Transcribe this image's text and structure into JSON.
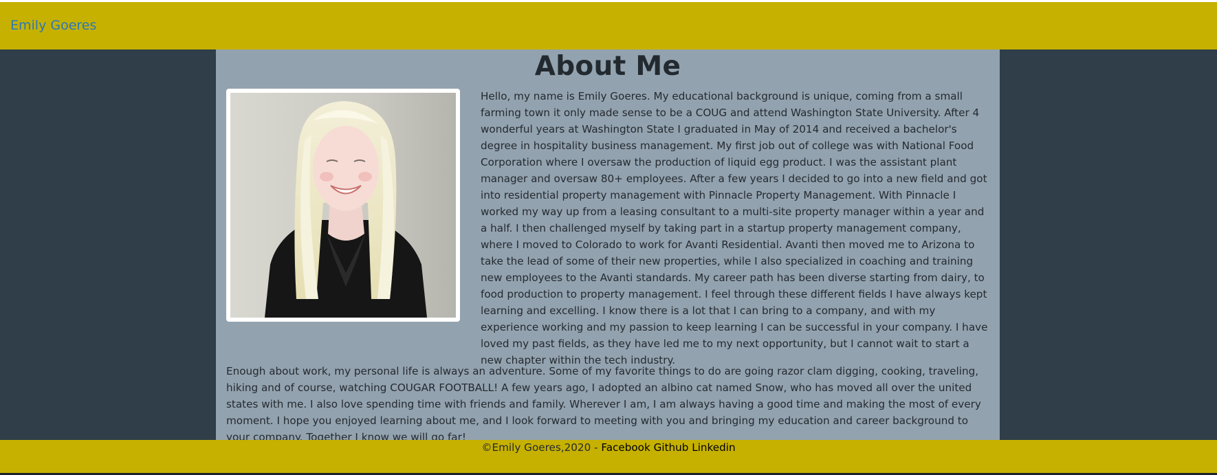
{
  "navbar": {
    "brand": "Emily Goeres",
    "background_color": "#c6b100",
    "brand_color": "#2a78b8"
  },
  "main": {
    "title": "About Me",
    "photo": {
      "description_icon": "portrait-photo"
    },
    "paragraphs": [
      "Hello, my name is Emily Goeres. My educational background is unique, coming from a small farming town it only made sense to be a COUG and attend Washington State University. After 4 wonderful years at Washington State I graduated in May of 2014 and received a bachelor's degree in hospitality business management. My first job out of college was with National Food Corporation where I oversaw the production of liquid egg product. I was the assistant plant manager and oversaw 80+ employees. After a few years I decided to go into a new field and got into residential property management with Pinnacle Property Management. With Pinnacle I worked my way up from a leasing consultant to a multi-site property manager within a year and a half. I then challenged myself by taking part in a startup property management company, where I moved to Colorado to work for Avanti Residential. Avanti then moved me to Arizona to take the lead of some of their new properties, while I also specialized in coaching and training new employees to the Avanti standards. My career path has been diverse starting from dairy, to food production to property management. I feel through these different fields I have always kept learning and excelling. I know there is a lot that I can bring to a company, and with my experience working and my passion to keep learning I can be successful in your company. I have loved my past fields, as they have led me to my next opportunity, but I cannot wait to start a new chapter within the tech industry.",
      "Enough about work, my personal life is always an adventure. Some of my favorite things to do are going razor clam digging, cooking, traveling, hiking and of course, watching COUGAR FOOTBALL! A few years ago, I adopted an albino cat named Snow, who has moved all over the united states with me. I also love spending time with friends and family. Wherever I am, I am always having a good time and making the most of every moment. I hope you enjoyed learning about me, and I look forward to meeting with you and bringing my education and career background to your company. Together I know we will go far!"
    ],
    "background_color": "#93a2af"
  },
  "page": {
    "background_color": "#2f3e48"
  },
  "footer": {
    "copyright": "©Emily Goeres,2020 - ",
    "links": [
      "Facebook",
      "Github",
      "Linkedin"
    ]
  }
}
